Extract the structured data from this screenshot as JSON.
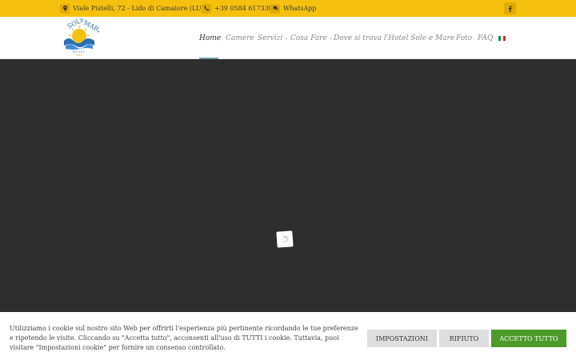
{
  "topbar": {
    "address": "Viale Pistelli, 72 - Lido di Camaiore (LU)",
    "phone": "+39 0584 617339",
    "whatsapp": "WhatsApp",
    "icons": {
      "address": "map-marker-icon",
      "phone": "phone-icon",
      "whatsapp": "chat-icon",
      "social": "facebook-icon"
    }
  },
  "logo": {
    "line1": "SOLE",
    "line2": "MARE",
    "amp": "e",
    "sub": "HOTEL"
  },
  "nav": {
    "items": [
      {
        "label": "Home",
        "active": true
      },
      {
        "label": "Camere"
      },
      {
        "label": "Servizi",
        "dropdown": true
      },
      {
        "label": "Cosa Fare",
        "dropdown": true
      },
      {
        "label": "Dove si trova l'Hotel Sole e Mare"
      },
      {
        "label": "Foto"
      },
      {
        "label": "FAQ"
      }
    ],
    "language": "italian-flag"
  },
  "cookie": {
    "text": "Utilizziamo i cookie sul nostro sito Web per offrirti l'esperienza più pertinente ricordando le tue preferenze e ripetendo le visite. Cliccando su \"Accetta tutto\", acconsenti all'uso di TUTTI i cookie. Tuttavia, puoi visitare \"Impostazioni cookie\" per fornire un consenso controllato.",
    "settings_label": "IMPOSTAZIONI",
    "reject_label": "RIFIUTO",
    "accept_label": "ACCETTO TUTTO"
  },
  "colors": {
    "topbar": "#f6c10e",
    "hero": "#2d2d2d",
    "accept": "#4c9a2a"
  }
}
